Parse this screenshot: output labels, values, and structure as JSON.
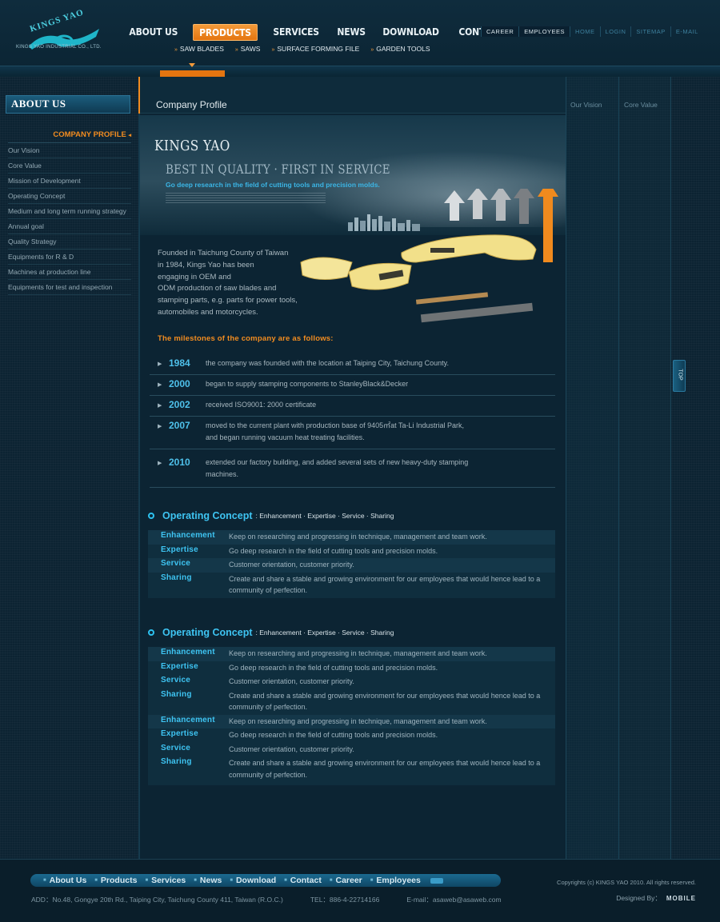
{
  "logo": {
    "brand": "KINGS YAO",
    "tagline": "KINGS YAO INDUSTRIAL CO., LTD."
  },
  "main_nav": [
    {
      "label": "ABOUT US",
      "active": false
    },
    {
      "label": "PRODUCTS",
      "active": true
    },
    {
      "label": "SERVICES",
      "active": false
    },
    {
      "label": "NEWS",
      "active": false
    },
    {
      "label": "DOWNLOAD",
      "active": false
    },
    {
      "label": "CONTACT",
      "active": false
    }
  ],
  "sub_nav": [
    "SAW BLADES",
    "SAWS",
    "SURFACE FORMING FILE",
    "GARDEN TOOLS"
  ],
  "top_nav": {
    "career": "CAREER",
    "employees": "EMPLOYEES",
    "home": "HOME",
    "login": "LOGIN",
    "sitemap": "SITEMAP",
    "email": "E-MAIL",
    "sep": "·"
  },
  "sidebar": {
    "heading": "ABOUT US",
    "active": "COMPANY PROFILE",
    "items": [
      "Our Vision",
      "Core Value",
      "Mission of Development",
      "Operating Concept",
      "Medium and long term running strategy",
      "Annual goal",
      "Quality Strategy",
      "Equipments for R & D",
      "Machines at production line",
      "Equipments for test and inspection"
    ]
  },
  "main": {
    "title": "Company Profile",
    "banner": {
      "line1": "KINGS YAO",
      "line2": "BEST IN QUALITY · FIRST IN SERVICE",
      "line3": "Go deep research in the field of cutting tools and precision molds."
    },
    "intro": [
      "Founded in Taichung County of Taiwan",
      "in 1984, Kings Yao has been",
      "engaging in OEM and",
      "ODM production of saw blades and",
      "stamping parts, e.g. parts for power tools,",
      "automobiles and motorcycles."
    ],
    "milestones_heading": "The milestones of the company are as follows:",
    "milestones": [
      {
        "year": "1984",
        "text": "the company was founded with the location at Taiping City, Taichung County."
      },
      {
        "year": "2000",
        "text": "began to supply stamping components to StanleyBlack&Decker"
      },
      {
        "year": "2002",
        "text": "received ISO9001: 2000 certificate"
      },
      {
        "year": "2007",
        "text": "moved to the current plant with production base of 9405㎡at Ta-Li Industrial Park, and began running vacuum heat treating facilities."
      },
      {
        "year": "2010",
        "text": "extended our factory building, and added several sets of new heavy-duty stamping machines."
      }
    ],
    "concept1": {
      "title": "Operating Concept",
      "subtitle": ": Enhancement · Expertise · Service · Sharing",
      "rows": [
        {
          "k": "Enhancement",
          "v": "Keep on researching and progressing in technique, management and team work."
        },
        {
          "k": "Expertise",
          "v": "Go deep research in the field of cutting tools and precision molds."
        },
        {
          "k": "Service",
          "v": "Customer orientation, customer priority."
        },
        {
          "k": "Sharing",
          "v": "Create and share a stable and growing environment for our employees that would hence lead to a community of perfection."
        }
      ]
    },
    "concept2": {
      "title": "Operating Concept",
      "subtitle": ": Enhancement · Expertise · Service · Sharing",
      "rows": [
        {
          "k": "Enhancement",
          "v": "Keep on researching and progressing in technique, management and team work."
        },
        {
          "k": "Expertise",
          "v": "Go deep research in the field of cutting tools and precision molds."
        },
        {
          "k": "Service",
          "v": "Customer orientation, customer priority."
        },
        {
          "k": "Sharing",
          "v": "Create and share a stable and growing environment for our employees that would hence lead to a community of perfection."
        },
        {
          "k": "Enhancement",
          "v": "Keep on researching and progressing in technique, management and team work."
        },
        {
          "k": "Expertise",
          "v": "Go deep research in the field of cutting tools and precision molds."
        },
        {
          "k": "Service",
          "v": "Customer orientation, customer priority."
        },
        {
          "k": "Sharing",
          "v": "Create and share a stable and growing environment for our employees that would hence lead to a community of perfection."
        }
      ]
    }
  },
  "right": {
    "col1": "Our Vision",
    "col2": "Core Value",
    "top_button": "TOP"
  },
  "footer": {
    "nav": [
      "About Us",
      "Products",
      "Services",
      "News",
      "Download",
      "Contact",
      "Career",
      "Employees"
    ],
    "address": "ADD：No.48, Gongye 20th Rd., Taiping City, Taichung County 411, Taiwan (R.O.C.)",
    "tel": "TEL：886-4-22714166",
    "email": "E-mail：asaweb@asaweb.com",
    "copyright": "Copyrights (c) KINGS YAO 2010. All rights reserved.",
    "designed_by": "Designed By：",
    "designer": "MOBILE"
  },
  "colors": {
    "accent": "#f28c20",
    "link": "#3ec4f2",
    "background": "#0c2332"
  }
}
